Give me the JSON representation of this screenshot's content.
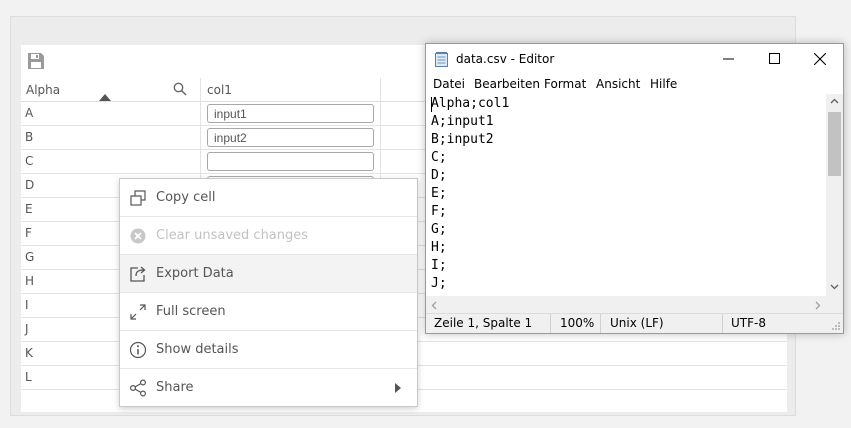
{
  "table": {
    "headers": {
      "alpha": "Alpha",
      "col1": "col1"
    },
    "rows": [
      {
        "key": "A",
        "value": "input1"
      },
      {
        "key": "B",
        "value": "input2"
      },
      {
        "key": "C",
        "value": ""
      },
      {
        "key": "D"
      },
      {
        "key": "E"
      },
      {
        "key": "F"
      },
      {
        "key": "G"
      },
      {
        "key": "H"
      },
      {
        "key": "I"
      },
      {
        "key": "J"
      },
      {
        "key": "K"
      },
      {
        "key": "L"
      }
    ]
  },
  "context_menu": {
    "items": [
      {
        "label": "Copy cell",
        "icon": "copy-icon",
        "enabled": true
      },
      {
        "label": "Clear unsaved changes",
        "icon": "clear-icon",
        "enabled": false
      },
      {
        "label": "Export Data",
        "icon": "export-icon",
        "enabled": true,
        "highlighted": true
      },
      {
        "label": "Full screen",
        "icon": "fullscreen-icon",
        "enabled": true
      },
      {
        "label": "Show details",
        "icon": "info-icon",
        "enabled": true
      },
      {
        "label": "Share",
        "icon": "share-icon",
        "enabled": true,
        "submenu": true
      }
    ]
  },
  "editor": {
    "title": "data.csv - Editor",
    "menu": [
      "Datei",
      "Bearbeiten",
      "Format",
      "Ansicht",
      "Hilfe"
    ],
    "lines": [
      "Alpha;col1",
      "A;input1",
      "B;input2",
      "C;",
      "D;",
      "E;",
      "F;",
      "G;",
      "H;",
      "I;",
      "J;"
    ],
    "status": {
      "position": "Zeile 1, Spalte 1",
      "zoom": "100%",
      "line_ending": "Unix (LF)",
      "encoding": "UTF-8"
    }
  }
}
